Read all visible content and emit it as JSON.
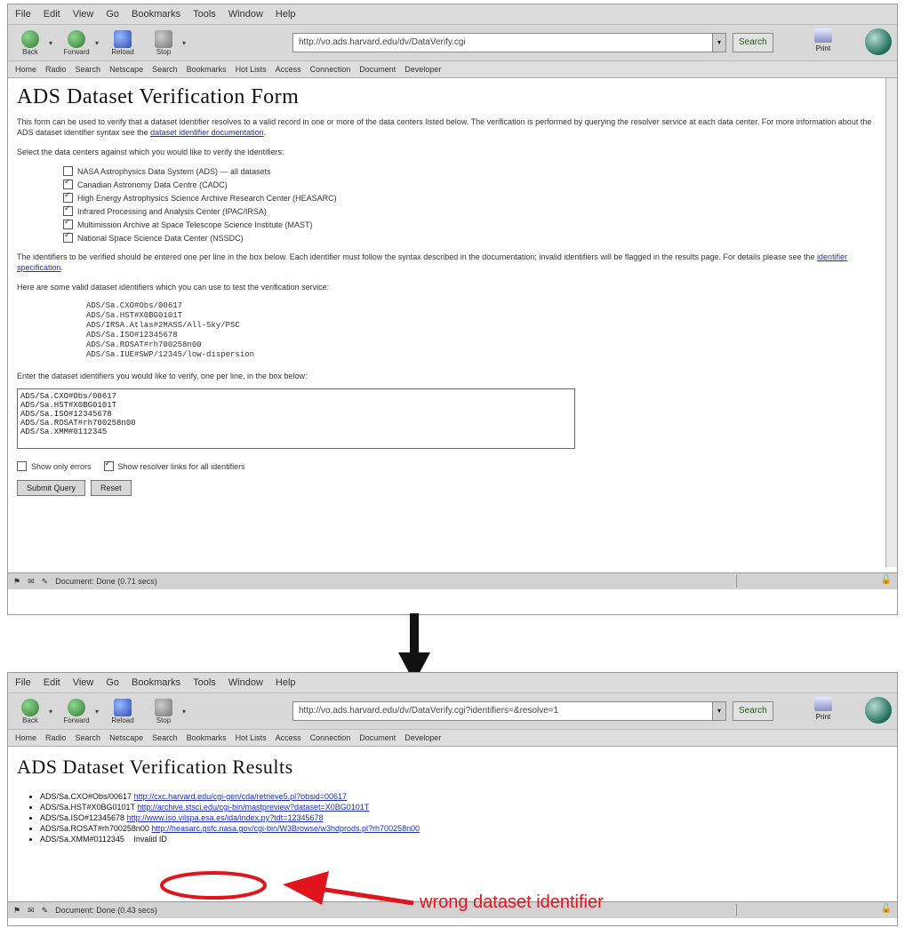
{
  "top_window": {
    "menu": [
      "File",
      "Edit",
      "View",
      "Go",
      "Bookmarks",
      "Tools",
      "Window",
      "Help"
    ],
    "toolbar": {
      "back": "Back",
      "forward": "Forward",
      "reload": "Reload",
      "stop": "Stop",
      "home": "Home",
      "url": "http://vo.ads.harvard.edu/dv/DataVerify.cgi",
      "search": "Search",
      "print": "Print"
    },
    "bookmarks": [
      "Home",
      "Radio",
      "Search",
      "Netscape",
      "Search",
      "Bookmarks",
      "Hot Lists",
      "Access",
      "Connection",
      "Document",
      "Developer"
    ],
    "page": {
      "title": "ADS Dataset Verification Form",
      "intro": "This form can be used to verify that a dataset identifier resolves to a valid record in one or more of the data centers listed below. The verification is performed by querying the resolver service at each data center. For more information about the ADS dataset identifier syntax see the",
      "intro_link": "dataset identifier documentation",
      "select_prompt": "Select the data centers against which you would like to verify the identifiers:",
      "centers": [
        {
          "label": "NASA Astrophysics Data System (ADS) — all datasets",
          "checked": false
        },
        {
          "label": "Canadian Astronomy Data Centre (CADC)",
          "checked": true
        },
        {
          "label": "High Energy Astrophysics Science Archive Research Center (HEASARC)",
          "checked": true
        },
        {
          "label": "Infrared Processing and Analysis Center (IPAC/IRSA)",
          "checked": true
        },
        {
          "label": "Multimission Archive at Space Telescope Science Institute (MAST)",
          "checked": true
        },
        {
          "label": "National Space Science Data Center (NSSDC)",
          "checked": true
        }
      ],
      "rules_text": "The identifiers to be verified should be entered one per line in the box below. Each identifier must follow the syntax described in the documentation; invalid identifiers will be flagged in the results page. For details please see the",
      "rules_link": "identifier specification",
      "examples_prompt": "Here are some valid dataset identifiers which you can use to test the verification service:",
      "examples": [
        "ADS/Sa.CXO#Obs/00617",
        "ADS/Sa.HST#X0BG0101T",
        "ADS/IRSA.Atlas#2MASS/All-Sky/PSC",
        "ADS/Sa.ISO#12345678",
        "ADS/Sa.ROSAT#rh700258n00",
        "ADS/Sa.IUE#SWP/12345/low-dispersion"
      ],
      "input_prompt": "Enter the dataset identifiers you would like to verify, one per line, in the box below:",
      "input_lines": [
        "ADS/Sa.CXO#Obs/00617",
        "ADS/Sa.HST#X0BG0101T",
        "ADS/Sa.ISO#12345678",
        "ADS/Sa.ROSAT#rh700258n00",
        "ADS/Sa.XMM#0112345"
      ],
      "option_1": "Show only errors",
      "option_1_checked": false,
      "option_2": "Show resolver links for all identifiers",
      "option_2_checked": true,
      "submit": "Submit Query",
      "reset": "Reset"
    },
    "status": "Document: Done (0.71 secs)"
  },
  "bottom_window": {
    "menu": [
      "File",
      "Edit",
      "View",
      "Go",
      "Bookmarks",
      "Tools",
      "Window",
      "Help"
    ],
    "toolbar": {
      "back": "Back",
      "forward": "Forward",
      "reload": "Reload",
      "stop": "Stop",
      "home": "Home",
      "url": "http://vo.ads.harvard.edu/dv/DataVerify.cgi?identifiers=&resolve=1",
      "search": "Search",
      "print": "Print"
    },
    "bookmarks": [
      "Home",
      "Radio",
      "Search",
      "Netscape",
      "Search",
      "Bookmarks",
      "Hot Lists",
      "Access",
      "Connection",
      "Document",
      "Developer"
    ],
    "page": {
      "title": "ADS Dataset Verification Results",
      "results": [
        {
          "id": "ADS/Sa.CXO#Obs/00617",
          "link": "http://cxc.harvard.edu/cgi-gen/cda/retrieve5.pl?obsid=00617"
        },
        {
          "id": "ADS/Sa.HST#X0BG0101T",
          "link": "http://archive.stsci.edu/cgi-bin/mastpreview?dataset=X0BG0101T"
        },
        {
          "id": "ADS/Sa.ISO#12345678",
          "link": "http://www.iso.vilspa.esa.es/ida/index.py?tdt=12345678"
        },
        {
          "id": "ADS/Sa.ROSAT#rh700258n00",
          "link": "http://heasarc.gsfc.nasa.gov/cgi-bin/W3Browse/w3hdprods.pl?rh700258n00"
        },
        {
          "id": "ADS/Sa.XMM#0112345",
          "link": "",
          "status": "Invalid ID"
        }
      ]
    },
    "status": "Document: Done (0.43 secs)"
  },
  "annotation": {
    "text": "wrong dataset identifier",
    "color": "#e0141c"
  }
}
